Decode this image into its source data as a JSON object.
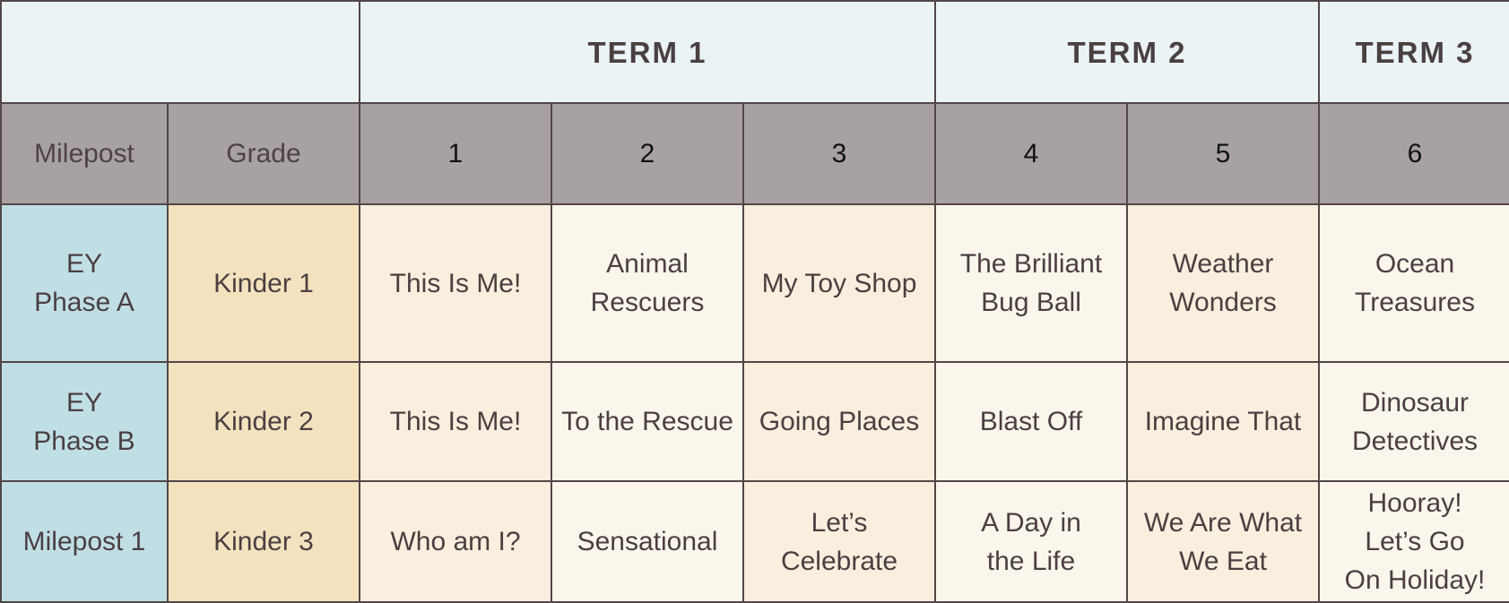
{
  "terms": [
    {
      "label": "TERM 1",
      "span": 3
    },
    {
      "label": "TERM 2",
      "span": 2
    },
    {
      "label": "TERM 3",
      "span": 1
    }
  ],
  "headers": {
    "milepost": "Milepost",
    "grade": "Grade",
    "units": [
      "1",
      "2",
      "3",
      "4",
      "5",
      "6"
    ]
  },
  "rows": [
    {
      "milepost": "EY\nPhase A",
      "grade": "Kinder 1",
      "units": [
        "This Is Me!",
        "Animal\nRescuers",
        "My Toy Shop",
        "The Brilliant\nBug Ball",
        "Weather\nWonders",
        "Ocean\nTreasures"
      ]
    },
    {
      "milepost": "EY\nPhase B",
      "grade": "Kinder 2",
      "units": [
        "This Is Me!",
        "To the Rescue",
        "Going Places",
        "Blast Off",
        "Imagine That",
        "Dinosaur\nDetectives"
      ]
    },
    {
      "milepost": "Milepost 1",
      "grade": "Kinder 3",
      "units": [
        "Who am I?",
        "Sensational",
        "Let’s\nCelebrate",
        "A Day in\nthe Life",
        "We Are What\nWe Eat",
        "Hooray!\nLet’s Go\nOn Holiday!"
      ]
    }
  ],
  "colors": {
    "term_bg": "#eaf3f6",
    "header_bg": "#a7a1a1",
    "milepost_bg": "#c0dfe4",
    "grade_bg": "#f4e2bf",
    "cell_light": "#faf6ec",
    "cell_warm": "#f9efde",
    "border": "#524648",
    "text": "#4a3f42"
  }
}
